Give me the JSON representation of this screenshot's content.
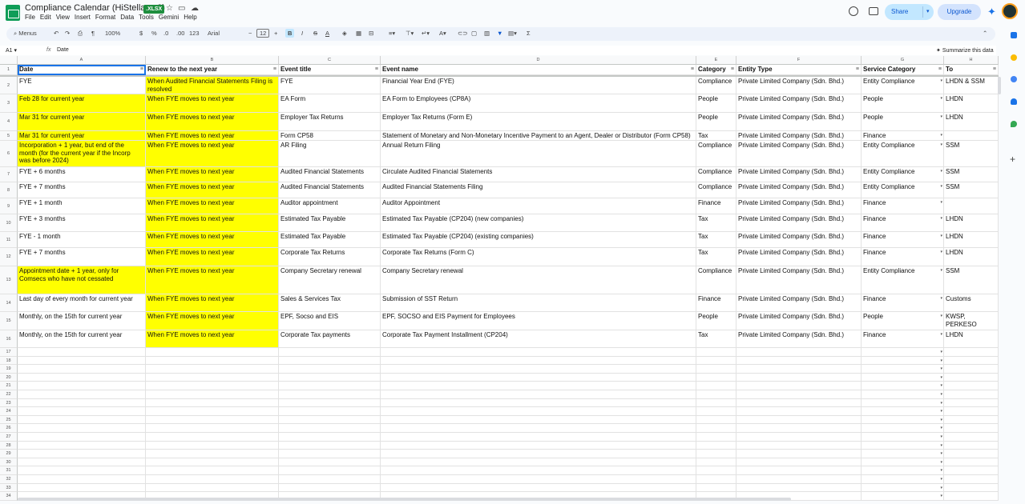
{
  "app": {
    "title": "Compliance Calendar (HiStellar, v2)",
    "badge": ".XLSX",
    "menus": [
      "File",
      "Edit",
      "View",
      "Insert",
      "Format",
      "Data",
      "Tools",
      "Gemini",
      "Help"
    ],
    "share_label": "Share",
    "upgrade_label": "Upgrade"
  },
  "toolbar": {
    "search_label": "Menus",
    "zoom": "100%",
    "currency": "$",
    "percent": "%",
    "dec_less": ".0",
    "dec_more": ".00",
    "number_format": "123",
    "font": "Arial",
    "font_size": "12",
    "bold": "B",
    "italic": "I",
    "strike": "S",
    "text_color": "A",
    "sum": "Σ"
  },
  "formula": {
    "cell_ref": "A1",
    "content": "Date",
    "summarize": "Summarize this data"
  },
  "columns": [
    "A",
    "B",
    "C",
    "D",
    "E",
    "F",
    "G",
    "H"
  ],
  "headers": [
    "Date",
    "Renew to the next year",
    "Event title",
    "Event name",
    "Category",
    "Entity Type",
    "Service Category",
    "To"
  ],
  "rows": [
    {
      "n": "2",
      "a": "FYE",
      "b": "When Audited Financial Statements Filing is resolved",
      "c": "FYE",
      "d": "Financial Year End (FYE)",
      "e": "Compliance",
      "f": "Private Limited Company (Sdn. Bhd.)",
      "g": "Entity Compliance",
      "h": "LHDN & SSM",
      "ay": false
    },
    {
      "n": "3",
      "a": "Feb 28 for current year",
      "b": "When FYE moves to next year",
      "c": "EA Form",
      "d": "EA Form to Employees (CP8A)",
      "e": "People",
      "f": "Private Limited Company (Sdn. Bhd.)",
      "g": "People",
      "h": "LHDN",
      "ay": true
    },
    {
      "n": "4",
      "a": "Mar 31 for current year",
      "b": "When FYE moves to next year",
      "c": "Employer Tax Returns",
      "d": "Employer Tax Returns (Form E)",
      "e": "People",
      "f": "Private Limited Company (Sdn. Bhd.)",
      "g": "People",
      "h": "LHDN",
      "ay": true
    },
    {
      "n": "5",
      "a": "Mar 31 for current year",
      "b": "When FYE moves to next year",
      "c": "Form CP58",
      "d": "Statement of Monetary and Non-Monetary Incentive Payment to an Agent, Dealer or Distributor (Form CP58)",
      "e": "Tax",
      "f": "Private Limited Company (Sdn. Bhd.)",
      "g": "Finance",
      "h": "",
      "ay": true
    },
    {
      "n": "6",
      "a": "Incorporation + 1 year, but end of the month (for the current year if the Incorp was before 2024)",
      "b": "When FYE moves to next year",
      "c": "AR Filing",
      "d": "Annual Return Filing",
      "e": "Compliance",
      "f": "Private Limited Company (Sdn. Bhd.)",
      "g": "Entity Compliance",
      "h": "SSM",
      "ay": true
    },
    {
      "n": "7",
      "a": "FYE + 6 months",
      "b": "When FYE moves to next year",
      "c": "Audited Financial Statements",
      "d": "Circulate Audited Financial Statements",
      "e": "Compliance",
      "f": "Private Limited Company (Sdn. Bhd.)",
      "g": "Entity Compliance",
      "h": "SSM",
      "ay": false
    },
    {
      "n": "8",
      "a": "FYE + 7 months",
      "b": "When FYE moves to next year",
      "c": "Audited Financial Statements",
      "d": "Audited Financial Statements Filing",
      "e": "Compliance",
      "f": "Private Limited Company (Sdn. Bhd.)",
      "g": "Entity Compliance",
      "h": "SSM",
      "ay": false
    },
    {
      "n": "9",
      "a": "FYE + 1 month",
      "b": "When FYE moves to next year",
      "c": "Auditor appointment",
      "d": "Auditor Appointment",
      "e": "Finance",
      "f": "Private Limited Company (Sdn. Bhd.)",
      "g": "Finance",
      "h": "",
      "ay": false
    },
    {
      "n": "10",
      "a": "FYE + 3 months",
      "b": "When FYE moves to next year",
      "c": "Estimated Tax Payable",
      "d": "Estimated Tax Payable (CP204) (new companies)",
      "e": "Tax",
      "f": "Private Limited Company (Sdn. Bhd.)",
      "g": "Finance",
      "h": "LHDN",
      "ay": false
    },
    {
      "n": "11",
      "a": "FYE - 1 month",
      "b": "When FYE moves to next year",
      "c": "Estimated Tax Payable",
      "d": "Estimated Tax Payable (CP204) (existing companies)",
      "e": "Tax",
      "f": "Private Limited Company (Sdn. Bhd.)",
      "g": "Finance",
      "h": "LHDN",
      "ay": false
    },
    {
      "n": "12",
      "a": "FYE + 7 months",
      "b": "When FYE moves to next year",
      "c": "Corporate Tax Returns",
      "d": "Corporate Tax Returns (Form C)",
      "e": "Tax",
      "f": "Private Limited Company (Sdn. Bhd.)",
      "g": "Finance",
      "h": "LHDN",
      "ay": false
    },
    {
      "n": "13",
      "a": "Appointment date + 1 year, only for Comsecs who have not cessated",
      "b": "When FYE moves to next year",
      "c": "Company Secretary renewal",
      "d": "Company Secretary renewal",
      "e": "Compliance",
      "f": "Private Limited Company (Sdn. Bhd.)",
      "g": "Entity Compliance",
      "h": "SSM",
      "ay": true
    },
    {
      "n": "14",
      "a": "Last day of every month for current year",
      "b": "When FYE moves to next year",
      "c": "Sales & Services Tax",
      "d": "Submission of SST Return",
      "e": "Finance",
      "f": "Private Limited Company (Sdn. Bhd.)",
      "g": "Finance",
      "h": "Customs",
      "ay": false
    },
    {
      "n": "15",
      "a": "Monthly, on the 15th for current year",
      "b": "When FYE moves to next year",
      "c": "EPF, Socso and EIS",
      "d": "EPF, SOCSO and EIS Payment for Employees",
      "e": "People",
      "f": "Private Limited Company (Sdn. Bhd.)",
      "g": "People",
      "h": "KWSP, PERKESO",
      "ay": false
    },
    {
      "n": "16",
      "a": "Monthly, on the 15th for current year",
      "b": "When FYE moves to next year",
      "c": "Corporate Tax payments",
      "d": "Corporate Tax Payment Installment (CP204)",
      "e": "Tax",
      "f": "Private Limited Company (Sdn. Bhd.)",
      "g": "Finance",
      "h": "LHDN",
      "ay": false
    }
  ],
  "empty_rows": [
    "17",
    "18",
    "19",
    "20",
    "21",
    "22",
    "23",
    "24",
    "25",
    "26",
    "27",
    "28",
    "29",
    "30",
    "31",
    "32",
    "33",
    "34"
  ],
  "colors": {
    "highlight": "#ffff00",
    "accent": "#0b57d0",
    "share_bg": "#c2e7ff"
  }
}
